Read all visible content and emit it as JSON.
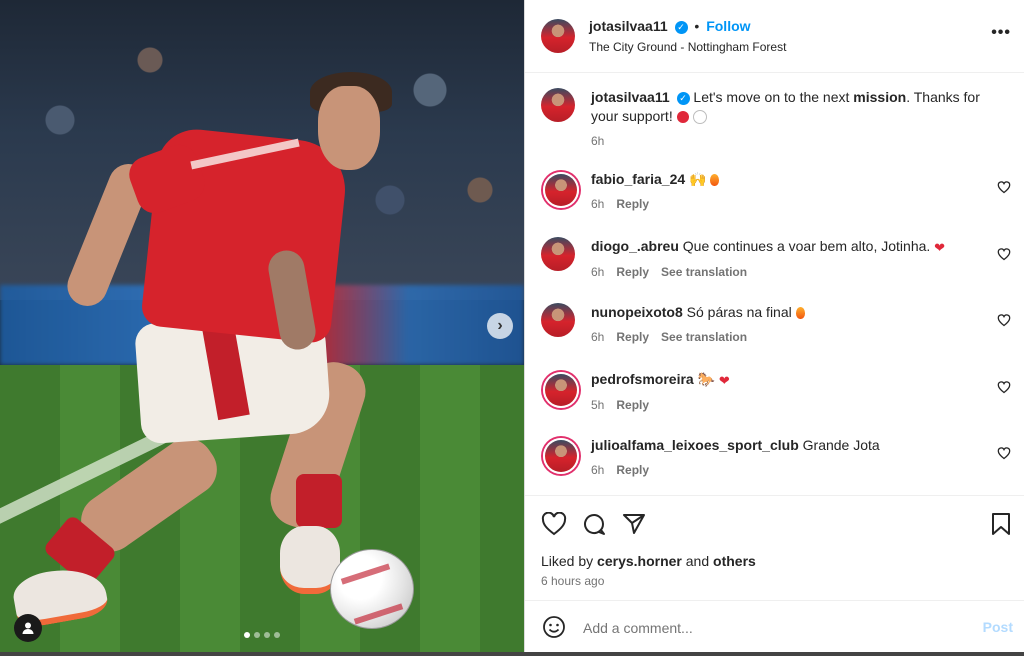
{
  "post": {
    "username": "jotasilvaa11",
    "follow_label": "Follow",
    "location": "The City Ground - Nottingham Forest",
    "more_label": "•••",
    "caption": {
      "before": "Let's move on to the next ",
      "bold": "mission",
      "after": ". Thanks for your support!",
      "time": "6h"
    },
    "carousel": {
      "next_label": "›",
      "slide_count": 4,
      "active_slide": 1
    }
  },
  "comments": [
    {
      "username": "fabio_faria_24",
      "text": "🙌",
      "emoji": [
        "fire"
      ],
      "time": "6h",
      "reply": "Reply",
      "translate": ""
    },
    {
      "username": "diogo_.abreu",
      "text": "Que continues a voar bem alto, Jotinha.",
      "emoji": [
        "heart"
      ],
      "time": "6h",
      "reply": "Reply",
      "translate": "See translation"
    },
    {
      "username": "nunopeixoto8",
      "text": "Só páras na final",
      "emoji": [
        "fire"
      ],
      "time": "6h",
      "reply": "Reply",
      "translate": "See translation"
    },
    {
      "username": "pedrofsmoreira",
      "text": "🐎",
      "emoji": [
        "heart"
      ],
      "time": "5h",
      "reply": "Reply",
      "translate": ""
    },
    {
      "username": "julioalfama_leixoes_sport_club",
      "text": "Grande Jota",
      "emoji": [],
      "time": "6h",
      "reply": "Reply",
      "translate": ""
    }
  ],
  "likes": {
    "prefix": "Liked by ",
    "user": "cerys.horner",
    "and": " and ",
    "others": "others",
    "time": "6 hours ago"
  },
  "add_comment": {
    "placeholder": "Add a comment...",
    "post_label": "Post"
  },
  "colors": {
    "accent": "#0095f6",
    "text": "#262626",
    "muted": "#737373"
  }
}
